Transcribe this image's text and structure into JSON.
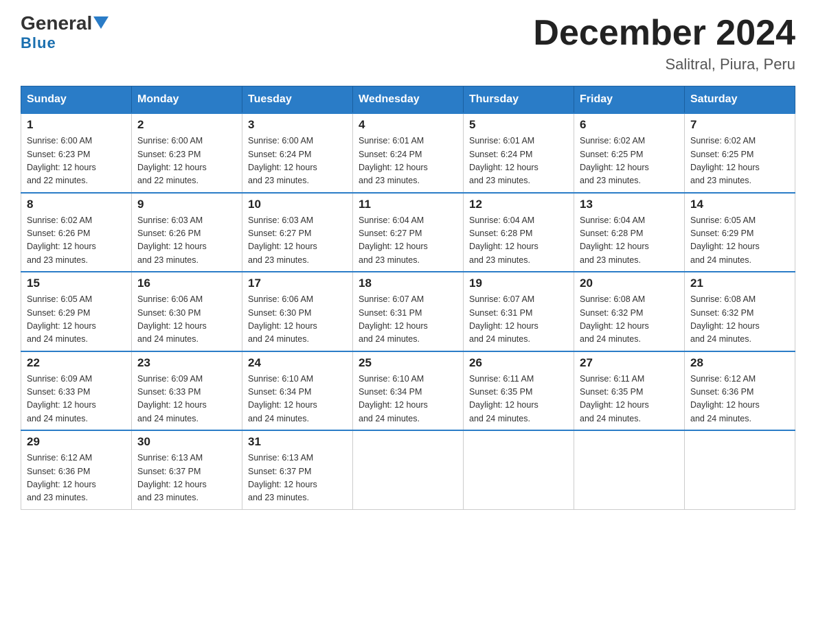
{
  "header": {
    "logo_general": "General",
    "logo_blue": "Blue",
    "month_title": "December 2024",
    "location": "Salitral, Piura, Peru"
  },
  "days_of_week": [
    "Sunday",
    "Monday",
    "Tuesday",
    "Wednesday",
    "Thursday",
    "Friday",
    "Saturday"
  ],
  "weeks": [
    [
      {
        "day": "1",
        "sunrise": "6:00 AM",
        "sunset": "6:23 PM",
        "daylight": "12 hours and 22 minutes."
      },
      {
        "day": "2",
        "sunrise": "6:00 AM",
        "sunset": "6:23 PM",
        "daylight": "12 hours and 22 minutes."
      },
      {
        "day": "3",
        "sunrise": "6:00 AM",
        "sunset": "6:24 PM",
        "daylight": "12 hours and 23 minutes."
      },
      {
        "day": "4",
        "sunrise": "6:01 AM",
        "sunset": "6:24 PM",
        "daylight": "12 hours and 23 minutes."
      },
      {
        "day": "5",
        "sunrise": "6:01 AM",
        "sunset": "6:24 PM",
        "daylight": "12 hours and 23 minutes."
      },
      {
        "day": "6",
        "sunrise": "6:02 AM",
        "sunset": "6:25 PM",
        "daylight": "12 hours and 23 minutes."
      },
      {
        "day": "7",
        "sunrise": "6:02 AM",
        "sunset": "6:25 PM",
        "daylight": "12 hours and 23 minutes."
      }
    ],
    [
      {
        "day": "8",
        "sunrise": "6:02 AM",
        "sunset": "6:26 PM",
        "daylight": "12 hours and 23 minutes."
      },
      {
        "day": "9",
        "sunrise": "6:03 AM",
        "sunset": "6:26 PM",
        "daylight": "12 hours and 23 minutes."
      },
      {
        "day": "10",
        "sunrise": "6:03 AM",
        "sunset": "6:27 PM",
        "daylight": "12 hours and 23 minutes."
      },
      {
        "day": "11",
        "sunrise": "6:04 AM",
        "sunset": "6:27 PM",
        "daylight": "12 hours and 23 minutes."
      },
      {
        "day": "12",
        "sunrise": "6:04 AM",
        "sunset": "6:28 PM",
        "daylight": "12 hours and 23 minutes."
      },
      {
        "day": "13",
        "sunrise": "6:04 AM",
        "sunset": "6:28 PM",
        "daylight": "12 hours and 23 minutes."
      },
      {
        "day": "14",
        "sunrise": "6:05 AM",
        "sunset": "6:29 PM",
        "daylight": "12 hours and 24 minutes."
      }
    ],
    [
      {
        "day": "15",
        "sunrise": "6:05 AM",
        "sunset": "6:29 PM",
        "daylight": "12 hours and 24 minutes."
      },
      {
        "day": "16",
        "sunrise": "6:06 AM",
        "sunset": "6:30 PM",
        "daylight": "12 hours and 24 minutes."
      },
      {
        "day": "17",
        "sunrise": "6:06 AM",
        "sunset": "6:30 PM",
        "daylight": "12 hours and 24 minutes."
      },
      {
        "day": "18",
        "sunrise": "6:07 AM",
        "sunset": "6:31 PM",
        "daylight": "12 hours and 24 minutes."
      },
      {
        "day": "19",
        "sunrise": "6:07 AM",
        "sunset": "6:31 PM",
        "daylight": "12 hours and 24 minutes."
      },
      {
        "day": "20",
        "sunrise": "6:08 AM",
        "sunset": "6:32 PM",
        "daylight": "12 hours and 24 minutes."
      },
      {
        "day": "21",
        "sunrise": "6:08 AM",
        "sunset": "6:32 PM",
        "daylight": "12 hours and 24 minutes."
      }
    ],
    [
      {
        "day": "22",
        "sunrise": "6:09 AM",
        "sunset": "6:33 PM",
        "daylight": "12 hours and 24 minutes."
      },
      {
        "day": "23",
        "sunrise": "6:09 AM",
        "sunset": "6:33 PM",
        "daylight": "12 hours and 24 minutes."
      },
      {
        "day": "24",
        "sunrise": "6:10 AM",
        "sunset": "6:34 PM",
        "daylight": "12 hours and 24 minutes."
      },
      {
        "day": "25",
        "sunrise": "6:10 AM",
        "sunset": "6:34 PM",
        "daylight": "12 hours and 24 minutes."
      },
      {
        "day": "26",
        "sunrise": "6:11 AM",
        "sunset": "6:35 PM",
        "daylight": "12 hours and 24 minutes."
      },
      {
        "day": "27",
        "sunrise": "6:11 AM",
        "sunset": "6:35 PM",
        "daylight": "12 hours and 24 minutes."
      },
      {
        "day": "28",
        "sunrise": "6:12 AM",
        "sunset": "6:36 PM",
        "daylight": "12 hours and 24 minutes."
      }
    ],
    [
      {
        "day": "29",
        "sunrise": "6:12 AM",
        "sunset": "6:36 PM",
        "daylight": "12 hours and 23 minutes."
      },
      {
        "day": "30",
        "sunrise": "6:13 AM",
        "sunset": "6:37 PM",
        "daylight": "12 hours and 23 minutes."
      },
      {
        "day": "31",
        "sunrise": "6:13 AM",
        "sunset": "6:37 PM",
        "daylight": "12 hours and 23 minutes."
      },
      null,
      null,
      null,
      null
    ]
  ],
  "labels": {
    "sunrise": "Sunrise:",
    "sunset": "Sunset:",
    "daylight": "Daylight:"
  }
}
